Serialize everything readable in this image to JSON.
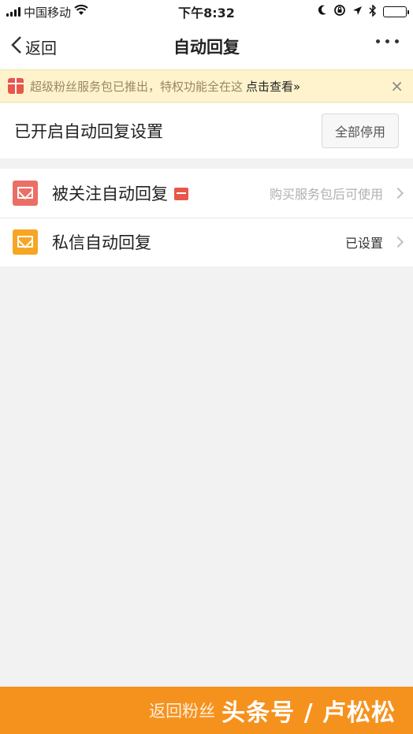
{
  "status_bar": {
    "carrier": "中国移动",
    "time": "下午8:32",
    "icons": [
      "signal-icon",
      "wifi-icon",
      "moon-icon",
      "rotation-lock-icon",
      "location-icon",
      "bluetooth-icon",
      "battery-icon"
    ],
    "battery_level": 0.4
  },
  "nav": {
    "back_label": "返回",
    "title": "自动回复",
    "more_icon": "more-dots-icon"
  },
  "banner": {
    "text": "超级粉丝服务包已推出，特权功能全在这",
    "link": "点击查看»",
    "close": "×",
    "icon": "gift-icon"
  },
  "settings": {
    "title": "已开启自动回复设置",
    "disable_all_label": "全部停用"
  },
  "list": [
    {
      "label": "被关注自动回复",
      "value": "购买服务包后可使用",
      "icon": "envelope-icon",
      "icon_color": "#ec6f66",
      "locked": true
    },
    {
      "label": "私信自动回复",
      "value": "已设置",
      "icon": "envelope-edit-icon",
      "icon_color": "#f6a623",
      "locked": false
    }
  ],
  "bottom_bar": {
    "text": "返回粉丝",
    "watermark": "头条号 / 卢松松",
    "color": "#f5921e"
  }
}
